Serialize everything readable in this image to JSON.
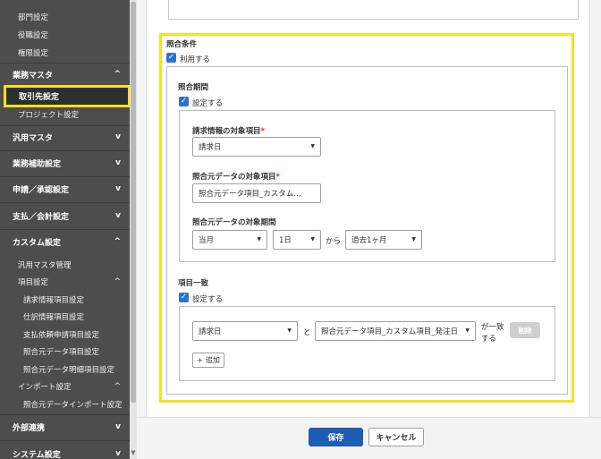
{
  "sidebar": {
    "sub_items_top": [
      "部門設定",
      "役職設定",
      "権限設定"
    ],
    "business_master": {
      "label": "業務マスタ",
      "chevron": "^"
    },
    "active_item": "取引先設定",
    "project_item": "プロジェクト設定",
    "sections": [
      {
        "label": "汎用マスタ",
        "chevron": "v"
      },
      {
        "label": "業務補助設定",
        "chevron": "v"
      },
      {
        "label": "申請／承認設定",
        "chevron": "v"
      },
      {
        "label": "支払／会計設定",
        "chevron": "v"
      }
    ],
    "custom": {
      "label": "カスタム設定",
      "chevron": "^"
    },
    "custom_items": {
      "general_master": "汎用マスタ管理",
      "item_settings": "項目設定",
      "item_settings_chevron": "^",
      "items": [
        "請求情報項目設定",
        "仕訳情報項目設定",
        "支払依頼申請項目設定",
        "照合元データ項目設定",
        "照合元データ明細項目設定"
      ],
      "import_settings": "インポート設定",
      "import_chevron": "^",
      "import_items": [
        "照合元データインポート設定"
      ]
    },
    "external": {
      "label": "外部連携",
      "chevron": "v"
    },
    "system": {
      "label": "システム設定",
      "chevron": "v"
    }
  },
  "matching": {
    "title": "照合条件",
    "use_label": "利用する",
    "period": {
      "title": "照合期間",
      "setting_label": "設定する",
      "invoice_field_label": "請求情報の対象項目",
      "invoice_field_value": "請求日",
      "source_field_label": "照合元データの対象項目",
      "source_field_value": "照合元データ項目_カスタム…",
      "source_period_label": "照合元データの対象期間",
      "month_value": "当月",
      "day_value": "1日",
      "kara": "から",
      "range_value": "過去1ヶ月"
    },
    "item_match": {
      "title": "項目一致",
      "setting_label": "設定する",
      "left_value": "請求日",
      "to": "と",
      "right_value": "照合元データ項目_カスタム項目_発注日",
      "match_text_1": "が一致",
      "match_text_2": "する",
      "delete_label": "削除",
      "add_label": "追加",
      "add_icon": "+"
    }
  },
  "required_mark": "*",
  "check_glyph": "✓",
  "dropdown_glyph": "▼",
  "footer": {
    "save": "保存",
    "cancel": "キャンセル"
  }
}
